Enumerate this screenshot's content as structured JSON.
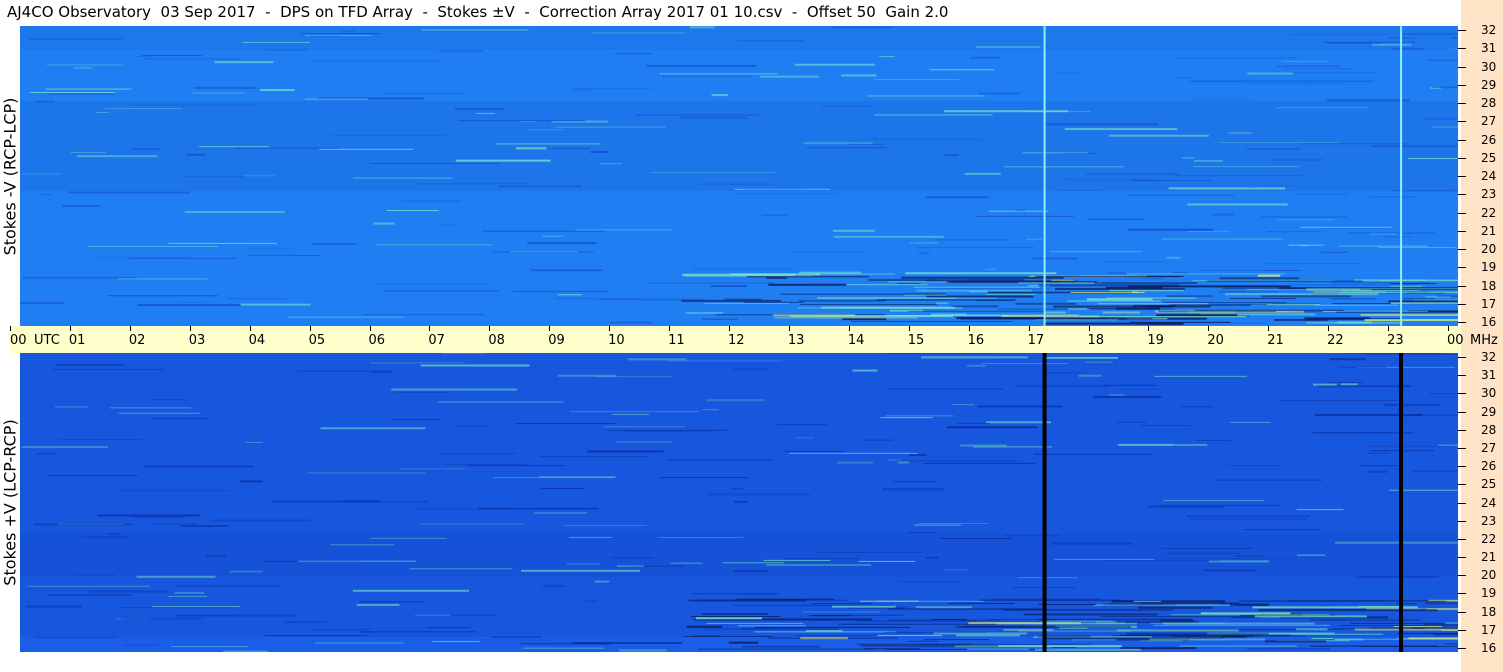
{
  "title": "AJ4CO Observatory  03 Sep 2017  -  DPS on TFD Array  -  Stokes ±V  -  Correction Array 2017 01 10.csv  -  Offset 50  Gain 2.0",
  "chart_data": [
    {
      "type": "heatmap",
      "panel": "top",
      "ylabel": "Stokes -V (RCP-LCP)",
      "x_ticks": [
        "00",
        "01",
        "02",
        "03",
        "04",
        "05",
        "06",
        "07",
        "08",
        "09",
        "10",
        "11",
        "12",
        "13",
        "14",
        "15",
        "16",
        "17",
        "18",
        "19",
        "20",
        "21",
        "22",
        "23",
        "00"
      ],
      "x_unit": "UTC",
      "y_ticks": [
        "32",
        "31",
        "30",
        "29",
        "28",
        "27",
        "26",
        "25",
        "24",
        "23",
        "22",
        "21",
        "20",
        "19",
        "18",
        "17",
        "16"
      ],
      "y_unit": "MHz",
      "ylim": [
        16,
        32
      ],
      "xlim": [
        0,
        24
      ],
      "colors": {
        "background": "#1f7ff2",
        "dark": "#1448c8",
        "bright": "#7fe8c8"
      },
      "features": [
        {
          "kind": "vertical-line",
          "utc": 17.1,
          "color": "#8ff0ee"
        },
        {
          "kind": "vertical-line",
          "utc": 23.05,
          "color": "#8ff0ee"
        }
      ]
    },
    {
      "type": "heatmap",
      "panel": "bottom",
      "ylabel": "Stokes +V (LCP-RCP)",
      "x_ticks": [
        "00",
        "01",
        "02",
        "03",
        "04",
        "05",
        "06",
        "07",
        "08",
        "09",
        "10",
        "11",
        "12",
        "13",
        "14",
        "15",
        "16",
        "17",
        "18",
        "19",
        "20",
        "21",
        "22",
        "23",
        "00"
      ],
      "x_unit": "UTC",
      "y_ticks": [
        "32",
        "31",
        "30",
        "29",
        "28",
        "27",
        "26",
        "25",
        "24",
        "23",
        "22",
        "21",
        "20",
        "19",
        "18",
        "17",
        "16"
      ],
      "y_unit": "MHz",
      "ylim": [
        16,
        32
      ],
      "xlim": [
        0,
        24
      ],
      "colors": {
        "background": "#1a5ee8",
        "dark": "#0a2a9a",
        "bright": "#70e0c0"
      },
      "features": [
        {
          "kind": "vertical-line",
          "utc": 17.1,
          "color": "#000000"
        },
        {
          "kind": "vertical-line",
          "utc": 23.05,
          "color": "#000000"
        }
      ]
    }
  ]
}
